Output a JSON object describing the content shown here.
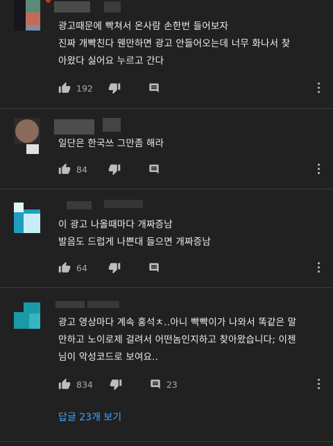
{
  "comments": [
    {
      "text_lines": [
        "광고때문에 빡쳐서 온사람 손한번 들어보자",
        "진짜 개빡친다 웬만하면 광고 안들어오는데  너무 화나서 찾",
        "아왔다 싫어요 누르고 간다"
      ],
      "likes": "192",
      "dislike_count": "",
      "reply_icon": "comment-icon"
    },
    {
      "text_lines": [
        "일단은 한국쓰 그만좀 해라"
      ],
      "likes": "84",
      "dislike_count": "",
      "reply_icon": "comment-icon"
    },
    {
      "text_lines": [
        "이 광고 나올때마다 개짜증남",
        "발음도 드럽게 나쁜대 들으면 개짜증남"
      ],
      "likes": "64",
      "dislike_count": "",
      "reply_icon": "comment-icon"
    },
    {
      "text_lines": [
        "광고 영상마다 계속 홍석ㅊ..아니 빡빡이가 나와서 똑같은 말",
        "만하고 노이로제 걸려서 어떤놈인지하고 찾아왔습니다; 이젠",
        "님이 악성코드로 보여요.."
      ],
      "likes": "834",
      "dislike_count": "",
      "reply_count": "23",
      "reply_icon": "comment-icon"
    }
  ],
  "view_replies": "답글 23개 보기",
  "colors": {
    "background": "#212121",
    "text": "#eeeeee",
    "secondary": "#aaaaaa",
    "link": "#3ea6ff",
    "divider": "#3a3a3a"
  }
}
